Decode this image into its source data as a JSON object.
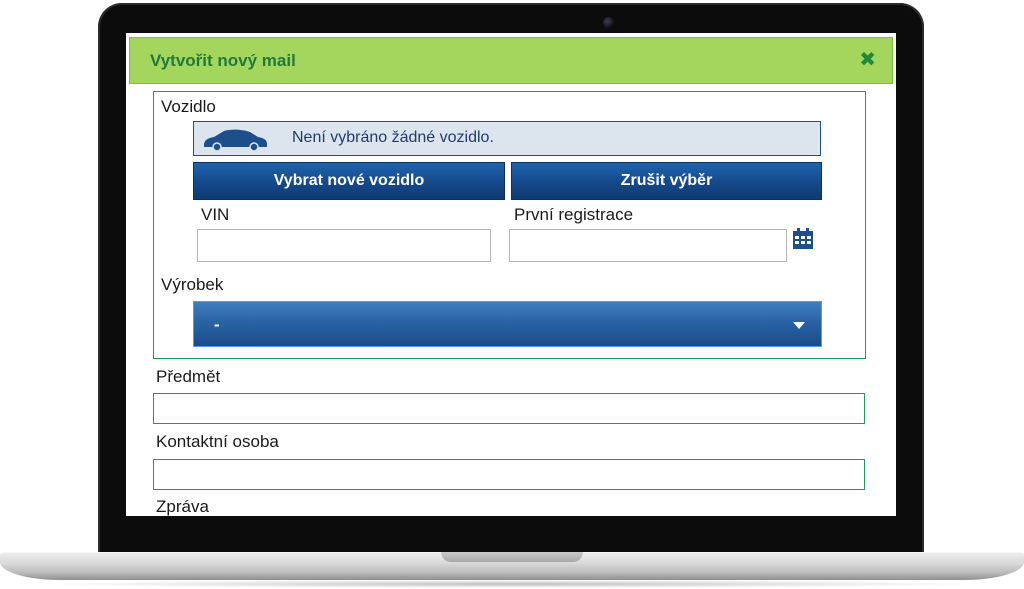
{
  "dialog": {
    "title": "Vytvořit nový mail"
  },
  "vehicle": {
    "section_label": "Vozidlo",
    "status_text": "Není vybráno žádné vozidlo.",
    "select_new_button": "Vybrat nové vozidlo",
    "cancel_selection_button": "Zrušit výběr",
    "vin_label": "VIN",
    "vin_value": "",
    "first_registration_label": "První registrace",
    "first_registration_value": ""
  },
  "product": {
    "label": "Výrobek",
    "selected_value": "-"
  },
  "subject": {
    "label": "Předmět",
    "value": ""
  },
  "contact_person": {
    "label": "Kontaktní osoba",
    "value": ""
  },
  "message": {
    "label": "Zpráva"
  },
  "colors": {
    "header_bg": "#a4d65e",
    "header_text": "#1f7a3c",
    "fieldset_border": "#1f9a5a",
    "button_blue": "#15498a",
    "status_bg": "#dce4ee"
  },
  "icons": {
    "close": "close-icon",
    "car": "car-icon",
    "calendar": "calendar-icon",
    "dropdown": "chevron-down-icon"
  }
}
